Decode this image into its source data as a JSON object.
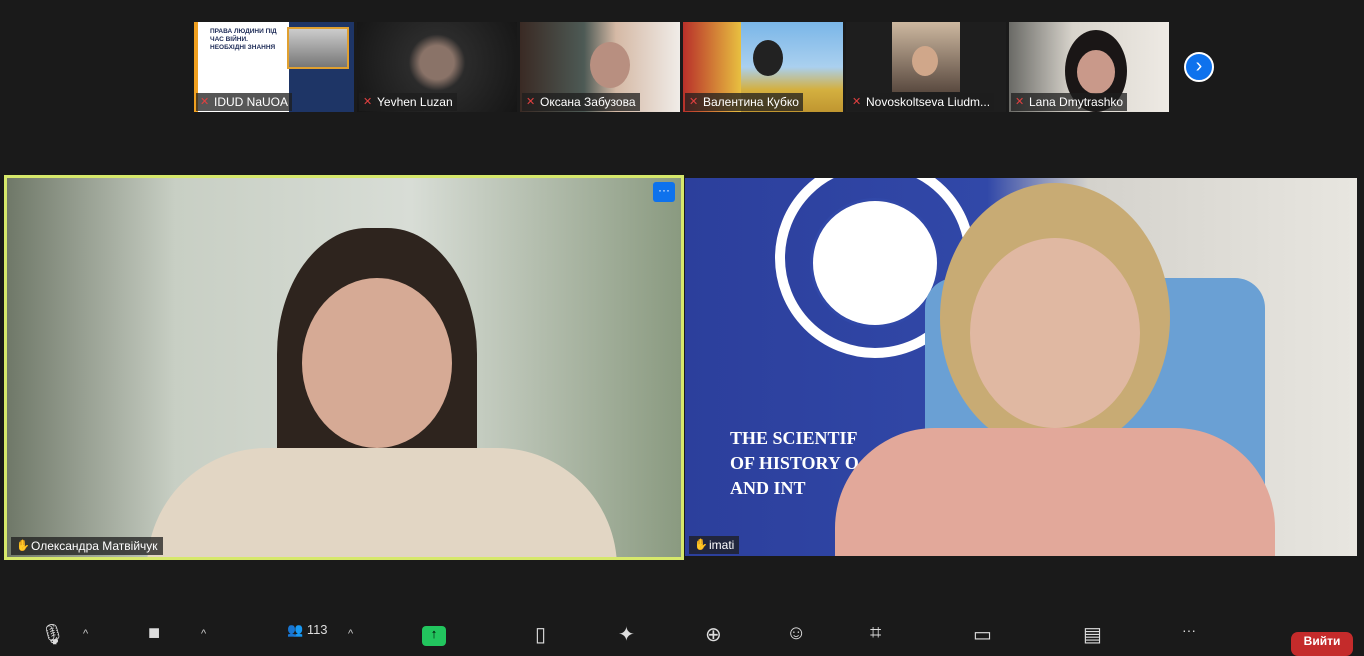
{
  "thumbnails": [
    {
      "name": "IDUD NaUOA",
      "muted": true,
      "poster_title": "ПРАВА ЛЮДИНИ ПІД ЧАС ВІЙНИ. НЕОБХІДНІ ЗНАННЯ"
    },
    {
      "name": "Yevhen Luzan",
      "muted": true
    },
    {
      "name": "Оксана Забузова",
      "muted": true
    },
    {
      "name": "Валентина Кубко",
      "muted": true
    },
    {
      "name": "Novoskoltseva Liudm...",
      "muted": true
    },
    {
      "name": "Lana Dmytrashko",
      "muted": true
    }
  ],
  "next_page_icon": "chevron-right-icon",
  "main": {
    "left": {
      "name": "Олександра Матвійчук",
      "more_label": "···"
    },
    "right": {
      "name": "imati",
      "background_text": [
        "THE SCIENTIF",
        "OF HISTORY O",
        "AND INT"
      ]
    }
  },
  "toolbar": {
    "participants_count": "113",
    "leave_label": "Вийти",
    "more_label": "···"
  },
  "colors": {
    "accent": "#0e72ed",
    "active_speaker": "#d6e86b",
    "leave": "#c42b2b",
    "share": "#22c55e"
  }
}
